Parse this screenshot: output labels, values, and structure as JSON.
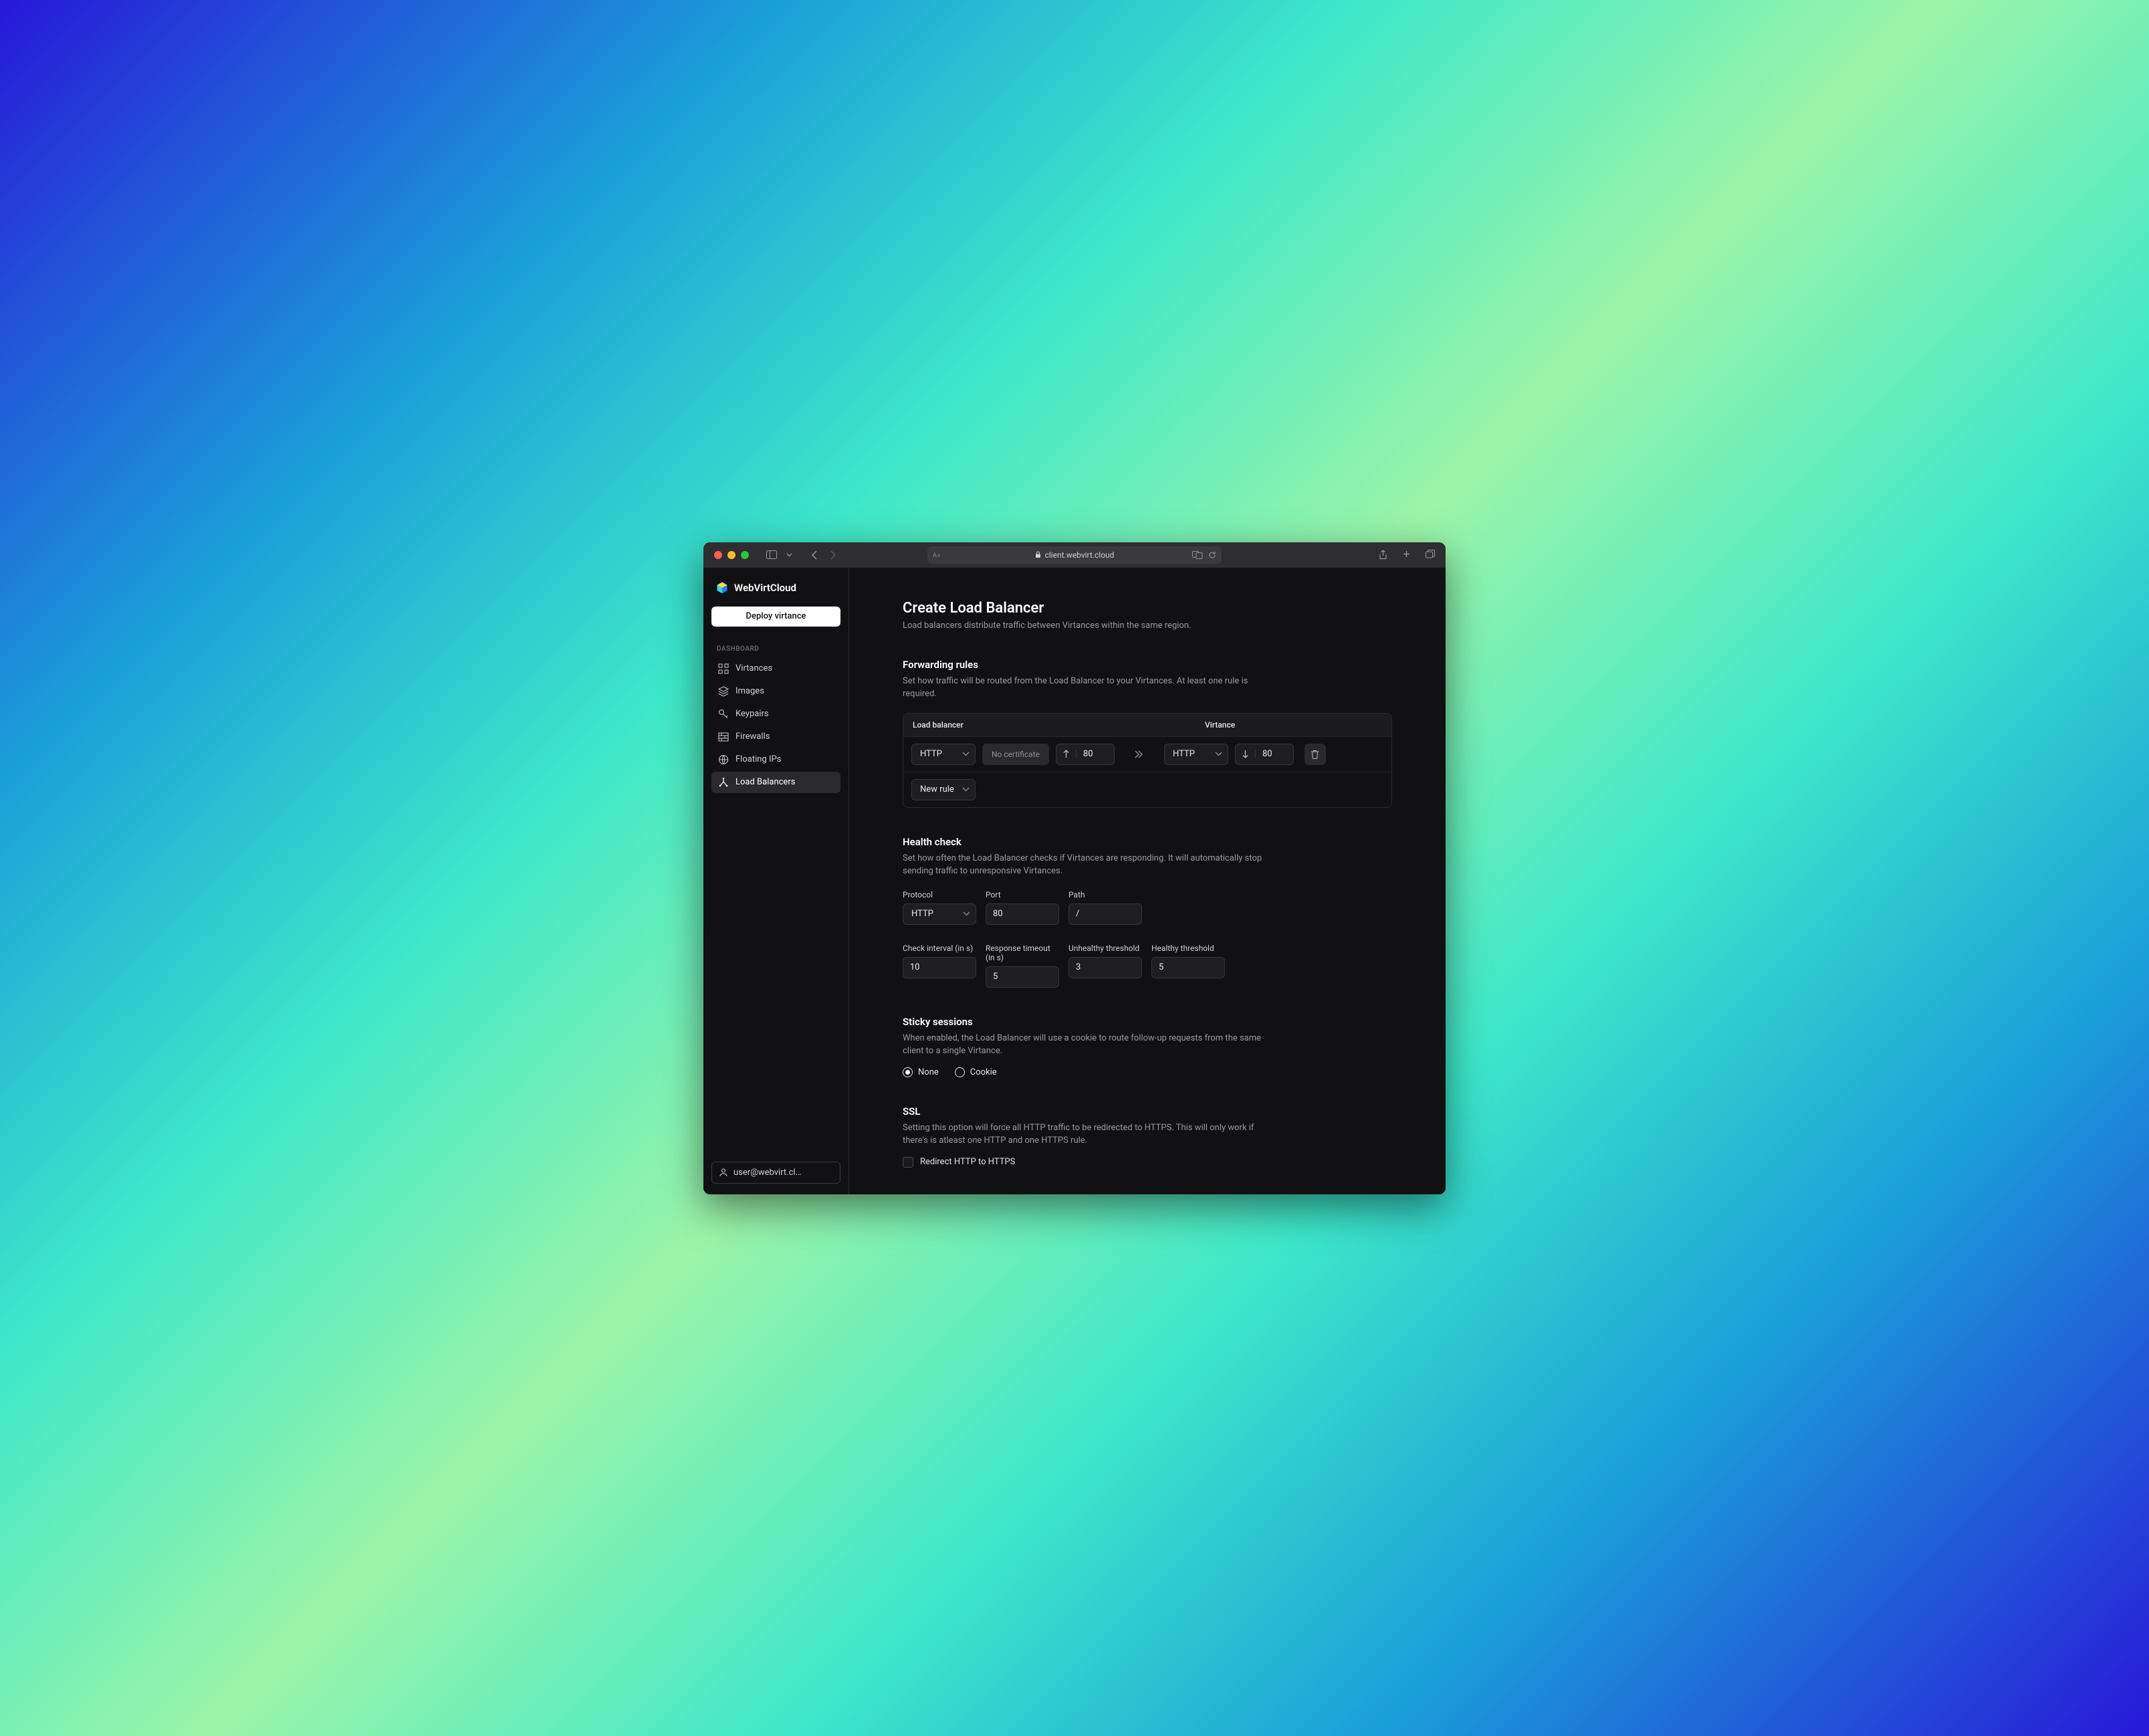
{
  "browser": {
    "url": "client.webvirt.cloud"
  },
  "brand": "WebVirtCloud",
  "deploy_label": "Deploy virtance",
  "dashboard_label": "DASHBOARD",
  "nav": {
    "virtances": "Virtances",
    "images": "Images",
    "keypairs": "Keypairs",
    "firewalls": "Firewalls",
    "floating": "Floating IPs",
    "lb": "Load Balancers"
  },
  "user_email": "user@webvirt.cl…",
  "page": {
    "title": "Create Load Balancer",
    "subtitle": "Load balancers distribute traffic between Virtances within the same region."
  },
  "forwarding": {
    "heading": "Forwarding rules",
    "desc": "Set how traffic will be routed from the Load Balancer to your Virtances. At least one rule is required.",
    "col_lb": "Load balancer",
    "col_v": "Virtance",
    "lb_proto": "HTTP",
    "no_cert": "No certificate",
    "lb_port": "80",
    "v_proto": "HTTP",
    "v_port": "80",
    "new_rule": "New rule"
  },
  "health": {
    "heading": "Health check",
    "desc": "Set how often the Load Balancer checks if Virtances are responding. It will automatically stop sending traffic to unresponsive Virtances.",
    "labels": {
      "protocol": "Protocol",
      "port": "Port",
      "path": "Path",
      "check": "Check interval (in s)",
      "timeout": "Response timeout (in s)",
      "unhealthy": "Unhealthy threshold",
      "healthy": "Healthy threshold"
    },
    "protocol": "HTTP",
    "port": "80",
    "path": "/",
    "check": "10",
    "timeout": "5",
    "unhealthy": "3",
    "healthy": "5"
  },
  "sticky": {
    "heading": "Sticky sessions",
    "desc": "When enabled, the Load Balancer will use a cookie to route follow-up requests from the same client to a single Virtance.",
    "none": "None",
    "cookie": "Cookie"
  },
  "ssl": {
    "heading": "SSL",
    "desc": "Setting this option will force all HTTP traffic to be redirected to HTTPS. This will only work if there's is atleast one HTTP and one HTTPS rule.",
    "redirect": "Redirect HTTP to HTTPS"
  }
}
